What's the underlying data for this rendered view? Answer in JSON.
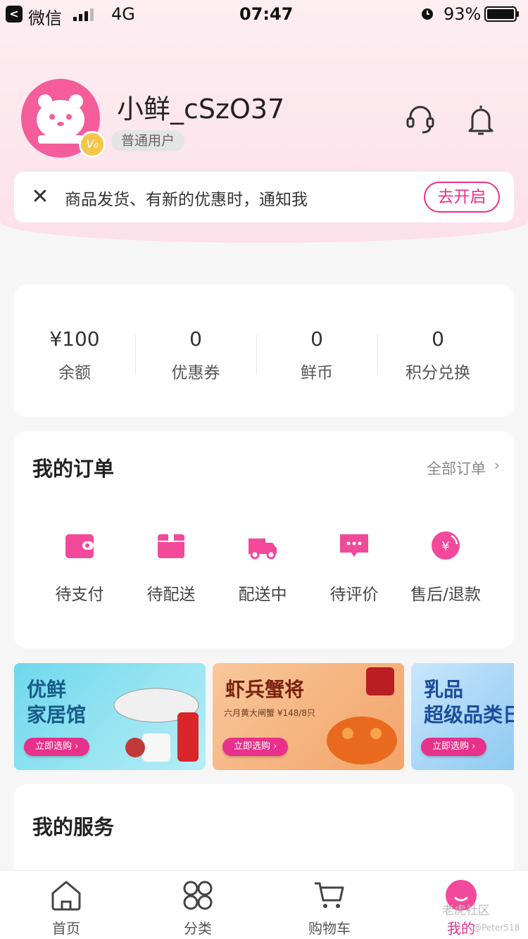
{
  "status_bar": {
    "back": "<",
    "carrier": "微信",
    "network": "4G",
    "time": "07:47",
    "battery": "93%"
  },
  "profile": {
    "username": "小鲜_cSzO37",
    "level": "普通用户",
    "vip_badge": "V₀"
  },
  "notification": {
    "close": "✕",
    "text": "商品发货、有新的优惠时，通知我",
    "button": "去开启"
  },
  "assets": [
    {
      "value": "¥100",
      "label": "余额"
    },
    {
      "value": "0",
      "label": "优惠券"
    },
    {
      "value": "0",
      "label": "鲜币"
    },
    {
      "value": "0",
      "label": "积分兑换"
    }
  ],
  "orders": {
    "title": "我的订单",
    "all": "全部订单",
    "arrow": "›",
    "items": [
      {
        "label": "待支付",
        "icon": "wallet-icon"
      },
      {
        "label": "待配送",
        "icon": "package-icon"
      },
      {
        "label": "配送中",
        "icon": "delivery-truck-icon"
      },
      {
        "label": "待评价",
        "icon": "comment-icon"
      },
      {
        "label": "售后/退款",
        "icon": "refund-icon"
      }
    ]
  },
  "banners": [
    {
      "title_line1": "优鲜",
      "title_line2": "家居馆",
      "sub": "",
      "button": "立即选购 ›"
    },
    {
      "title_line1": "虾兵蟹将",
      "title_line2": "",
      "sub": "六月黄大闸蟹 ¥148/8只",
      "button": "立即选购 ›"
    },
    {
      "title_line1": "乳品",
      "title_line2": "超级品类日",
      "sub": "",
      "button": "立即选购 ›"
    }
  ],
  "services": {
    "title": "我的服务"
  },
  "tabbar": [
    {
      "label": "首页",
      "icon": "home-icon"
    },
    {
      "label": "分类",
      "icon": "category-icon"
    },
    {
      "label": "购物车",
      "icon": "cart-icon"
    },
    {
      "label": "我的",
      "icon": "profile-icon"
    }
  ],
  "watermark": {
    "text": "老虎社区",
    "sub": "@Peter518"
  },
  "colors": {
    "accent": "#e8318a",
    "avatar": "#f45c9a",
    "header_bg": "#fde6ee"
  }
}
